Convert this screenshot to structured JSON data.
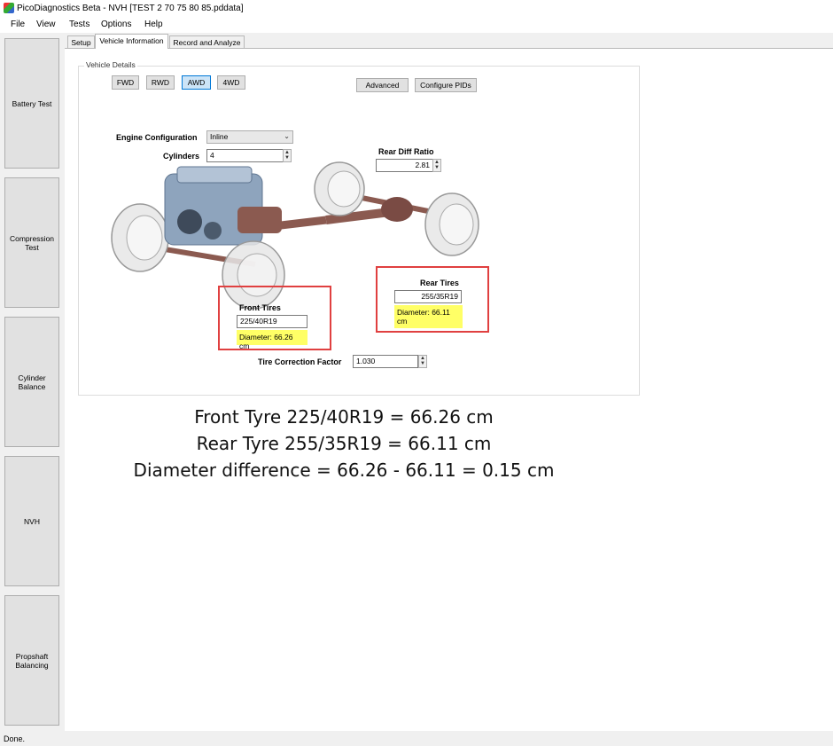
{
  "window": {
    "title": "PicoDiagnostics Beta - NVH [TEST 2 70 75 80 85.pddata]"
  },
  "menu": [
    "File",
    "View",
    "Tests",
    "Options",
    "Help"
  ],
  "sidebar": [
    {
      "label": "Battery Test"
    },
    {
      "label": "Compression Test"
    },
    {
      "label": "Cylinder Balance"
    },
    {
      "label": "NVH"
    },
    {
      "label": "Propshaft Balancing"
    }
  ],
  "tabs": [
    {
      "label": "Setup"
    },
    {
      "label": "Vehicle Information"
    },
    {
      "label": "Record and Analyze"
    }
  ],
  "vehicle": {
    "group_title": "Vehicle Details",
    "drive_buttons": [
      "FWD",
      "RWD",
      "AWD",
      "4WD"
    ],
    "selected_drive": "AWD",
    "advanced_label": "Advanced",
    "configure_pids_label": "Configure PIDs",
    "engine_config_label": "Engine Configuration",
    "engine_config_value": "Inline",
    "cylinders_label": "Cylinders",
    "cylinders_value": "4",
    "rear_diff_label": "Rear Diff Ratio",
    "rear_diff_value": "2.81",
    "front_tires_label": "Front Tires",
    "front_tires_value": "225/40R19",
    "front_diameter": "Diameter: 66.26 cm",
    "rear_tires_label": "Rear Tires",
    "rear_tires_value": "255/35R19",
    "rear_diameter": "Diameter: 66.11 cm",
    "tire_correction_label": "Tire Correction Factor",
    "tire_correction_value": "1.030"
  },
  "annotation": [
    "Front Tyre 225/40R19 = 66.26 cm",
    "Rear Tyre 255/35R19 = 66.11 cm",
    "Diameter difference = 66.26 - 66.11 = 0.15 cm"
  ],
  "status": {
    "text": "Done."
  },
  "colors": {
    "highlight": "#ffff66",
    "annotation_box": "#e04040",
    "selected": "#cce4f7"
  }
}
